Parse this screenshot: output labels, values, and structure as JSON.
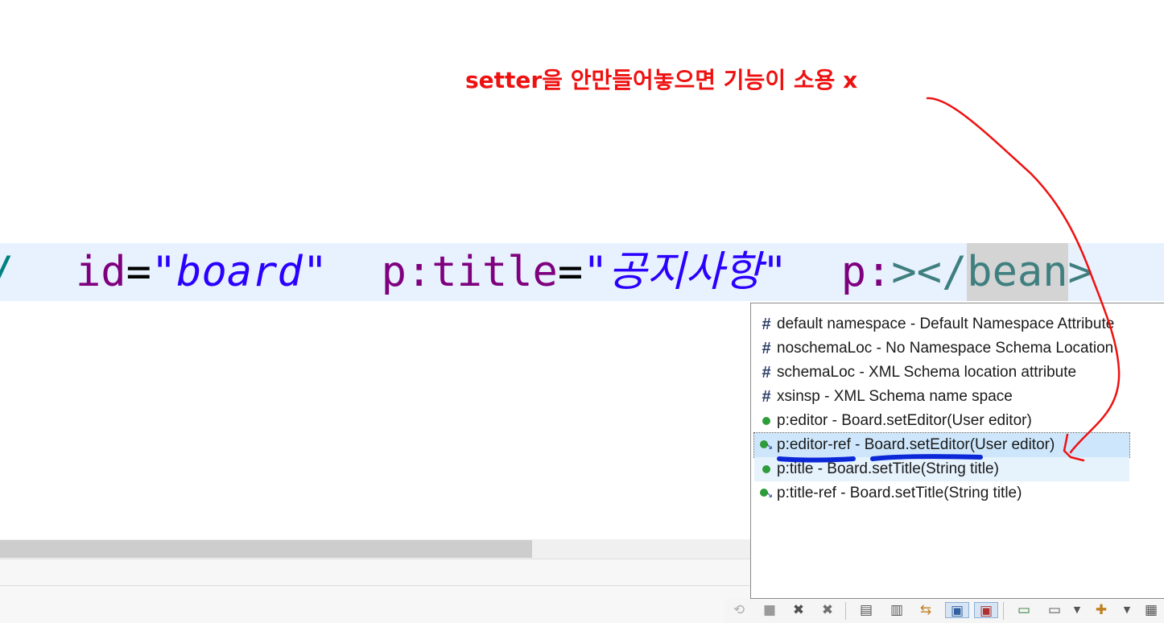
{
  "annotation": {
    "note": "setter을 안만들어놓으면 기능이 소용 x",
    "color": "#ee1111"
  },
  "editor": {
    "code_line": {
      "prefix": "/",
      "attr_id": "id",
      "eq": "=",
      "val_id": "\"board\"",
      "attr_title": "p:title",
      "val_title": "\"공지사항\"",
      "attr_p": "p:",
      "tag_close_open": "></",
      "tag_name": "bean",
      "tag_end": ">"
    },
    "line_highlight_color": "#e8f2fe"
  },
  "content_assist": {
    "items": [
      {
        "icon": "hash-icon",
        "label": "default namespace - Default Namespace Attribute"
      },
      {
        "icon": "hash-icon",
        "label": "noschemaLoc - No Namespace Schema Location"
      },
      {
        "icon": "hash-icon",
        "label": "schemaLoc - XML Schema location attribute"
      },
      {
        "icon": "hash-icon",
        "label": "xsinsp - XML Schema name space"
      },
      {
        "icon": "property-icon",
        "label": "p:editor - Board.setEditor(User editor)"
      },
      {
        "icon": "property-ref-icon",
        "label": "p:editor-ref - Board.setEditor(User editor)"
      },
      {
        "icon": "property-icon",
        "label": "p:title - Board.setTitle(String title)"
      },
      {
        "icon": "property-ref-icon",
        "label": "p:title-ref - Board.setTitle(String title)"
      }
    ],
    "selected_index": 5
  },
  "toolbar": {
    "icons": [
      "sync-icon",
      "stop-icon",
      "remove-icon",
      "remove-all-icon",
      "console-icon",
      "scroll-lock-icon",
      "word-wrap-icon",
      "pin-console-icon",
      "show-console-icon",
      "open-console-icon",
      "display-console-icon",
      "dropdown-icon",
      "new-console-icon",
      "dropdown-icon",
      "clipboard-icon"
    ]
  }
}
